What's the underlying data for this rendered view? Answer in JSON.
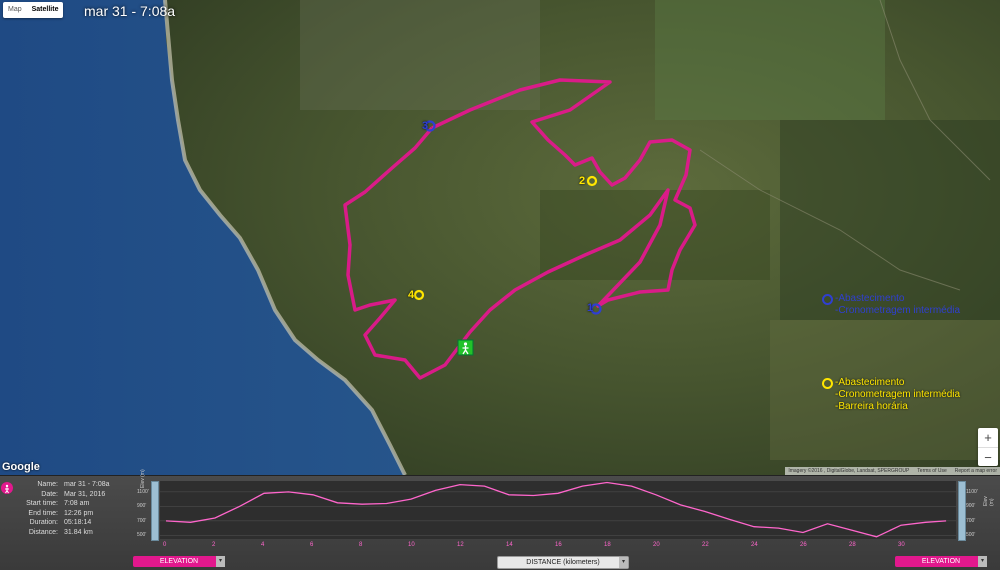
{
  "map": {
    "title": "mar 31 - 7:08a",
    "type_buttons": [
      "Map",
      "Satellite"
    ],
    "active_type": "Satellite",
    "logo": "Google",
    "copyright": [
      "Imagery ©2016 , DigitalGlobe, Landsat, SPERGROUP",
      "Terms of Use",
      "Report a map error"
    ],
    "zoom_in": "+",
    "zoom_out": "−",
    "colors": {
      "route": "#e2188d",
      "blue_marker": "#2f3fd0",
      "yellow_marker": "#ffe600",
      "start_marker": "#22c22a"
    },
    "markers": [
      {
        "label": "3",
        "color": "blue"
      },
      {
        "label": "2",
        "color": "yellow"
      },
      {
        "label": "4",
        "color": "yellow"
      },
      {
        "label": "1",
        "color": "blue"
      },
      {
        "label": "start",
        "icon": "hiker-icon"
      }
    ],
    "legend": {
      "blue": [
        "-Abastecimento",
        "-Cronometragem intermédia"
      ],
      "yellow": [
        "-Abastecimento",
        "-Cronometragem intermédia",
        "-Barreira horária"
      ]
    }
  },
  "track_info": {
    "rows": [
      {
        "key": "Name:",
        "value": "mar 31 - 7:08a"
      },
      {
        "key": "Date:",
        "value": "Mar 31, 2016"
      },
      {
        "key": "Start time:",
        "value": "7:08 am"
      },
      {
        "key": "End time:",
        "value": "12:26 pm"
      },
      {
        "key": "Duration:",
        "value": "05:18:14"
      },
      {
        "key": "Distance:",
        "value": "31.84 km"
      }
    ]
  },
  "chart_data": {
    "type": "line",
    "xlabel": "DISTANCE (kilometers)",
    "ylabel": "Elev (m)",
    "xlim": [
      0,
      32
    ],
    "ylim": [
      450,
      1250
    ],
    "x_ticks": [
      0,
      2,
      4,
      6,
      8,
      10,
      12,
      14,
      16,
      18,
      20,
      22,
      24,
      26,
      28,
      30
    ],
    "y_tick_labels": [
      "1100'",
      "900'",
      "700'",
      "500'"
    ],
    "y_ticks": [
      1100,
      900,
      700,
      500
    ],
    "x": [
      0,
      1,
      2,
      3,
      4,
      5,
      6,
      7,
      8,
      9,
      10,
      11,
      12,
      13,
      14,
      15,
      16,
      17,
      18,
      19,
      20,
      21,
      22,
      23,
      24,
      25,
      26,
      27,
      28,
      29,
      30,
      31,
      31.84
    ],
    "y": [
      700,
      680,
      740,
      900,
      1080,
      1100,
      1060,
      950,
      930,
      940,
      1000,
      1120,
      1200,
      1180,
      1060,
      1050,
      1080,
      1180,
      1230,
      1180,
      1060,
      920,
      830,
      720,
      620,
      600,
      540,
      660,
      570,
      480,
      640,
      680,
      700
    ],
    "series_name": "ELEVATION"
  },
  "controls": {
    "left_select": "ELEVATION",
    "x_select": "DISTANCE (kilometers)",
    "right_select": "ELEVATION",
    "dropdown_glyph": "▾"
  }
}
